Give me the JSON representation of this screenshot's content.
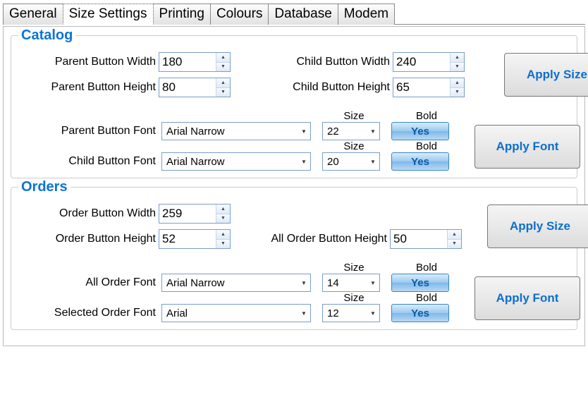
{
  "tabs": [
    "General",
    "Size Settings",
    "Printing",
    "Colours",
    "Database",
    "Modem"
  ],
  "activeTab": "Size Settings",
  "groups": {
    "catalog": {
      "title": "Catalog",
      "labels": {
        "parentWidth": "Parent Button Width",
        "parentHeight": "Parent Button Height",
        "childWidth": "Child Button Width",
        "childHeight": "Child Button Height",
        "parentFont": "Parent Button Font",
        "childFont": "Child Button Font",
        "size": "Size",
        "bold": "Bold"
      },
      "values": {
        "parentWidth": "180",
        "parentHeight": "80",
        "childWidth": "240",
        "childHeight": "65",
        "parentFont": "Arial Narrow",
        "parentFontSize": "22",
        "parentBold": "Yes",
        "childFont": "Arial Narrow",
        "childFontSize": "20",
        "childBold": "Yes"
      },
      "buttons": {
        "applySize": "Apply Size",
        "applyFont": "Apply Font"
      }
    },
    "orders": {
      "title": "Orders",
      "labels": {
        "orderWidth": "Order Button Width",
        "orderHeight": "Order Button Height",
        "allOrderHeight": "All Order Button Height",
        "allOrderFont": "All Order Font",
        "selectedOrderFont": "Selected Order Font",
        "size": "Size",
        "bold": "Bold"
      },
      "values": {
        "orderWidth": "259",
        "orderHeight": "52",
        "allOrderHeight": "50",
        "allOrderFont": "Arial Narrow",
        "allOrderFontSize": "14",
        "allOrderBold": "Yes",
        "selectedOrderFont": "Arial",
        "selectedOrderFontSize": "12",
        "selectedOrderBold": "Yes"
      },
      "buttons": {
        "applySize": "Apply Size",
        "applyFont": "Apply Font"
      }
    }
  }
}
